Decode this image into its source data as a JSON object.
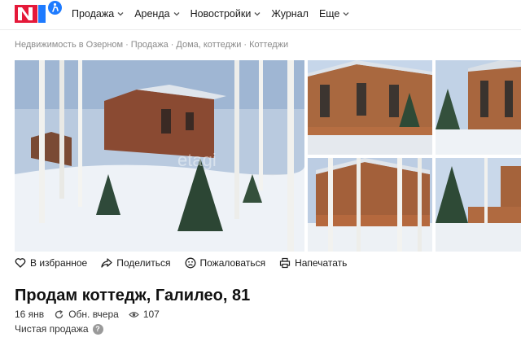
{
  "header": {
    "logo_text": "N1",
    "nav": [
      {
        "label": "Продажа",
        "has_dropdown": true
      },
      {
        "label": "Аренда",
        "has_dropdown": true
      },
      {
        "label": "Новостройки",
        "has_dropdown": true
      },
      {
        "label": "Журнал",
        "has_dropdown": false
      },
      {
        "label": "Еще",
        "has_dropdown": true
      }
    ]
  },
  "breadcrumb": [
    "Недвижимость в Озерном",
    "Продажа",
    "Дома, коттеджи",
    "Коттеджи"
  ],
  "breadcrumb_separator": "·",
  "gallery": {
    "photos": [
      "main-photo",
      "house-facade-photo",
      "house-side-photo",
      "house-birches-photo",
      "house-corner-photo"
    ],
    "watermark": "etagi"
  },
  "actions": {
    "favorite": "В избранное",
    "share": "Поделиться",
    "complain": "Пожаловаться",
    "print": "Напечатать"
  },
  "listing": {
    "title": "Продам коттедж, Галилео, 81",
    "date": "16 янв",
    "updated": "Обн. вчера",
    "views": "107",
    "sale_type": "Чистая продажа",
    "help_symbol": "?"
  },
  "colors": {
    "brand_red": "#e5193a",
    "brand_blue": "#1e7bff",
    "text_muted": "#8a8a8a"
  }
}
